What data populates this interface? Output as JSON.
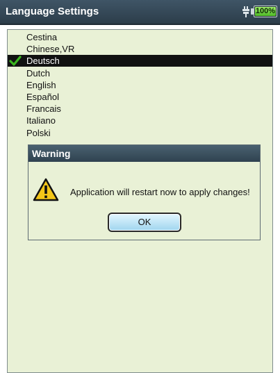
{
  "header": {
    "title": "Language Settings",
    "power_icon": "plug-icon",
    "battery": {
      "text": "100%",
      "level": 1.0
    }
  },
  "languages": {
    "selected_icon": "check-icon",
    "items": [
      {
        "label": "Cestina",
        "selected": false
      },
      {
        "label": "Chinese,VR",
        "selected": false
      },
      {
        "label": "Deutsch",
        "selected": true
      },
      {
        "label": "Dutch",
        "selected": false
      },
      {
        "label": "English",
        "selected": false
      },
      {
        "label": "Español",
        "selected": false
      },
      {
        "label": "Francais",
        "selected": false
      },
      {
        "label": "Italiano",
        "selected": false
      },
      {
        "label": "Polski",
        "selected": false
      }
    ]
  },
  "dialog": {
    "title": "Warning",
    "icon": "warning-icon",
    "message": "Application will restart now to apply changes!",
    "ok_label": "OK"
  },
  "colors": {
    "titlebar": "#34495a",
    "list_background": "#e9f1d6",
    "selection": "#111111",
    "checkmark": "#3ab51f",
    "battery": "#5bd02e",
    "warning": "#f3c619"
  }
}
